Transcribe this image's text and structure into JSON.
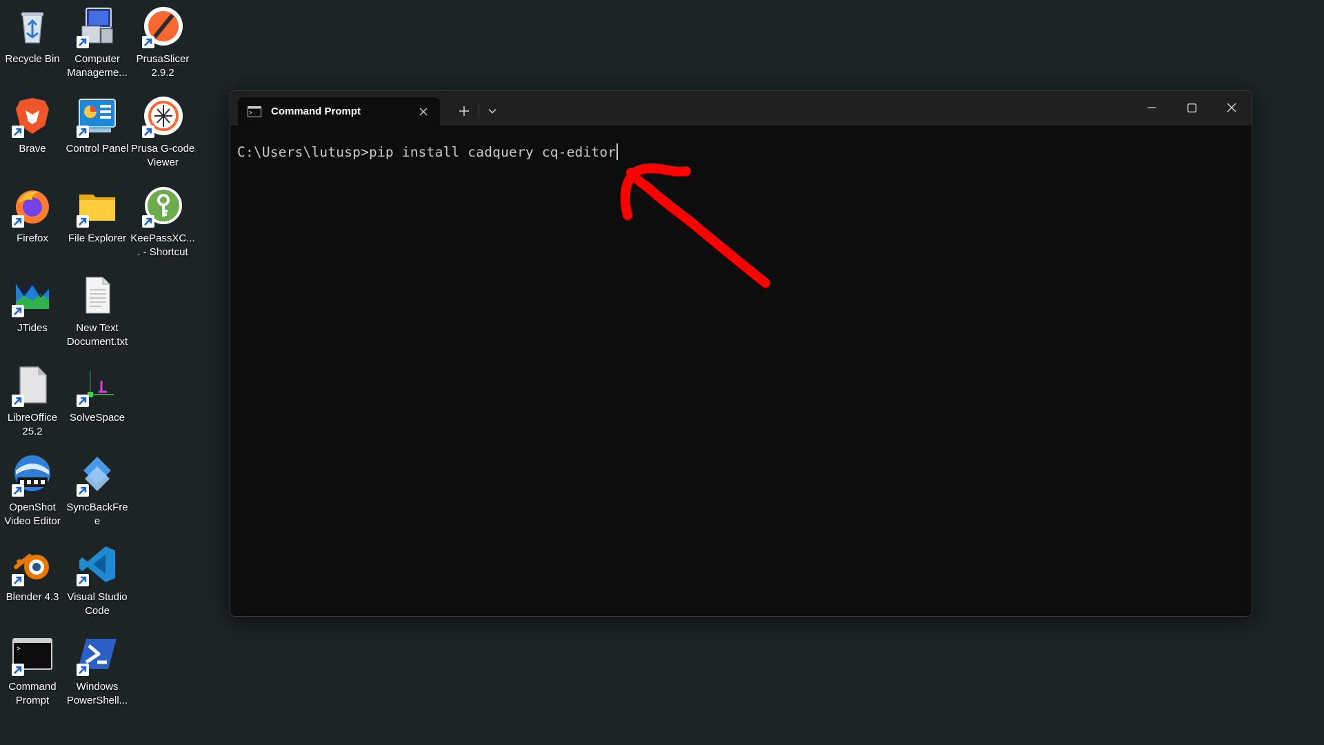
{
  "desktop": {
    "icons": [
      {
        "label": "Recycle Bin",
        "icon": "recycle-bin-icon",
        "shortcut": false
      },
      {
        "label": "Computer Manageme...",
        "icon": "computer-management-icon",
        "shortcut": true
      },
      {
        "label": "PrusaSlicer 2.9.2",
        "icon": "prusaslicer-icon",
        "shortcut": true
      },
      {
        "label": "Brave",
        "icon": "brave-icon",
        "shortcut": true
      },
      {
        "label": "Control Panel",
        "icon": "control-panel-icon",
        "shortcut": true
      },
      {
        "label": "Prusa G-code Viewer",
        "icon": "prusa-gcode-viewer-icon",
        "shortcut": true
      },
      {
        "label": "Firefox",
        "icon": "firefox-icon",
        "shortcut": true
      },
      {
        "label": "File Explorer",
        "icon": "file-explorer-icon",
        "shortcut": true
      },
      {
        "label": "KeePassXC.... - Shortcut",
        "icon": "keepassxc-icon",
        "shortcut": true
      },
      {
        "label": "JTides",
        "icon": "jtides-icon",
        "shortcut": true
      },
      {
        "label": "New Text Document.txt",
        "icon": "text-document-icon",
        "shortcut": false
      },
      {
        "label": "LibreOffice 25.2",
        "icon": "libreoffice-icon",
        "shortcut": true
      },
      {
        "label": "SolveSpace",
        "icon": "solvespace-icon",
        "shortcut": true
      },
      {
        "label": "OpenShot Video Editor",
        "icon": "openshot-icon",
        "shortcut": true
      },
      {
        "label": "SyncBackFree",
        "icon": "syncbackfree-icon",
        "shortcut": true
      },
      {
        "label": "Blender 4.3",
        "icon": "blender-icon",
        "shortcut": true
      },
      {
        "label": "Visual Studio Code",
        "icon": "vscode-icon",
        "shortcut": true
      },
      {
        "label": "Command Prompt",
        "icon": "command-prompt-icon",
        "shortcut": true
      },
      {
        "label": "Windows PowerShell...",
        "icon": "powershell-icon",
        "shortcut": true
      }
    ]
  },
  "terminal": {
    "tab_title": "Command Prompt",
    "tab_icon": "console-icon",
    "new_tab_icon": "plus-icon",
    "dropdown_icon": "chevron-down-icon",
    "minimize_icon": "minimize-icon",
    "maximize_icon": "maximize-icon",
    "close_icon": "close-icon",
    "prompt": "C:\\Users\\lutusp>",
    "command": "pip install cadquery cq-editor"
  },
  "annotation": {
    "color": "#ff0000",
    "icon": "red-arrow-annotation"
  }
}
